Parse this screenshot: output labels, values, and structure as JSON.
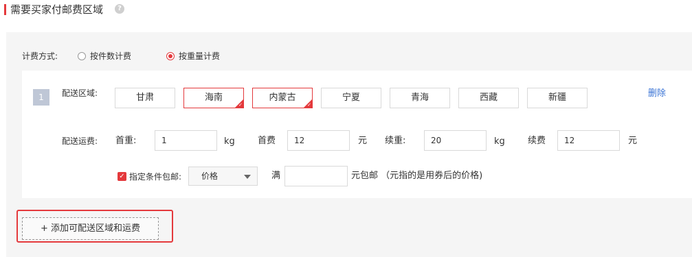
{
  "section": {
    "title": "需要买家付邮费区域",
    "help_icon": "question-circle-icon"
  },
  "billing": {
    "label": "计费方式:",
    "options": [
      "按件数计费",
      "按重量计费"
    ],
    "selected": "按重量计费"
  },
  "rule": {
    "index": "1",
    "region_label": "配送区域:",
    "regions": [
      {
        "name": "甘肃",
        "selected": false
      },
      {
        "name": "海南",
        "selected": true
      },
      {
        "name": "内蒙古",
        "selected": true
      },
      {
        "name": "宁夏",
        "selected": false
      },
      {
        "name": "青海",
        "selected": false
      },
      {
        "name": "西藏",
        "selected": false
      },
      {
        "name": "新疆",
        "selected": false
      }
    ],
    "delete_label": "删除",
    "fee_label": "配送运费:",
    "first_weight_label": "首重:",
    "first_weight": "1",
    "weight_unit": "kg",
    "first_fee_label": "首费",
    "first_fee": "12",
    "currency_unit": "元",
    "extra_weight_label": "续重:",
    "extra_weight": "20",
    "extra_fee_label": "续费",
    "extra_fee": "12",
    "free_shipping": {
      "checked": true,
      "label": "指定条件包邮:",
      "condition": "价格",
      "full_label": "满",
      "threshold": "",
      "suffix": "元包邮 （元指的是用券后的价格)"
    }
  },
  "add_button": "+ 添加可配送区域和运费",
  "colors": {
    "accent": "#e4393c",
    "link": "#3a74d5",
    "panel_bg": "#f5f5f5"
  }
}
